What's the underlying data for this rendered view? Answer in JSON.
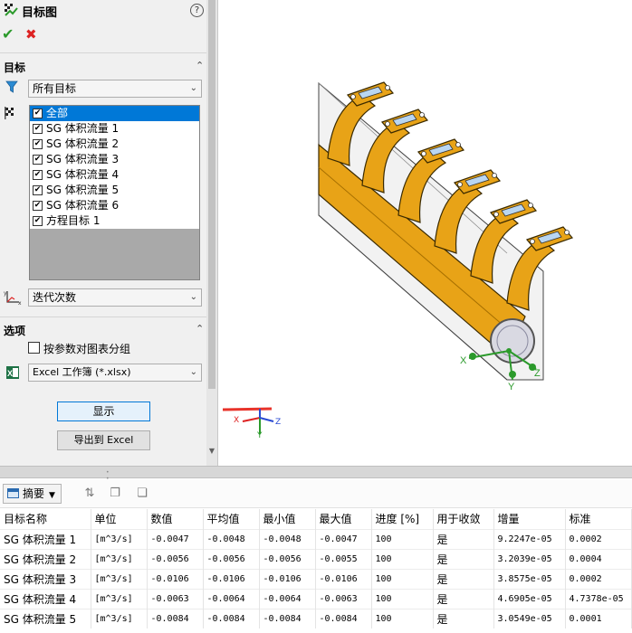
{
  "panel": {
    "title": "目标图",
    "help": "?",
    "ok": "✔",
    "cancel": "✖",
    "goals_section": "目标",
    "filter_select": "所有目标",
    "goals": [
      {
        "label": "全部",
        "checked": true,
        "selected": true
      },
      {
        "label": "SG 体积流量 1",
        "checked": true
      },
      {
        "label": "SG 体积流量 2",
        "checked": true
      },
      {
        "label": "SG 体积流量 3",
        "checked": true
      },
      {
        "label": "SG 体积流量 4",
        "checked": true
      },
      {
        "label": "SG 体积流量 5",
        "checked": true
      },
      {
        "label": "SG 体积流量 6",
        "checked": true
      },
      {
        "label": "方程目标 1",
        "checked": true
      }
    ],
    "axis_select": "迭代次数",
    "options_section": "选项",
    "group_checkbox_label": "按参数对图表分组",
    "group_checked": false,
    "excel_select": "Excel 工作簿 (*.xlsx)",
    "show_button": "显示",
    "export_button": "导出到 Excel"
  },
  "viewport": {
    "triad_labels": {
      "x": "X",
      "y": "Y",
      "z": "Z"
    },
    "accent": "#e8a317",
    "arrow_color": "#e8332a"
  },
  "toolbar": {
    "summary_button": "摘要"
  },
  "table": {
    "headers": [
      "目标名称",
      "单位",
      "数值",
      "平均值",
      "最小值",
      "最大值",
      "进度 [%]",
      "用于收敛",
      "增量",
      "标准"
    ],
    "rows": [
      [
        "SG 体积流量 1",
        "[m^3/s]",
        "-0.0047",
        "-0.0048",
        "-0.0048",
        "-0.0047",
        "100",
        "是",
        "9.2247e-05",
        "0.0002"
      ],
      [
        "SG 体积流量 2",
        "[m^3/s]",
        "-0.0056",
        "-0.0056",
        "-0.0056",
        "-0.0055",
        "100",
        "是",
        "3.2039e-05",
        "0.0004"
      ],
      [
        "SG 体积流量 3",
        "[m^3/s]",
        "-0.0106",
        "-0.0106",
        "-0.0106",
        "-0.0106",
        "100",
        "是",
        "3.8575e-05",
        "0.0002"
      ],
      [
        "SG 体积流量 4",
        "[m^3/s]",
        "-0.0063",
        "-0.0064",
        "-0.0064",
        "-0.0063",
        "100",
        "是",
        "4.6905e-05",
        "4.7378e-05"
      ],
      [
        "SG 体积流量 5",
        "[m^3/s]",
        "-0.0084",
        "-0.0084",
        "-0.0084",
        "-0.0084",
        "100",
        "是",
        "3.0549e-05",
        "0.0001"
      ]
    ]
  }
}
